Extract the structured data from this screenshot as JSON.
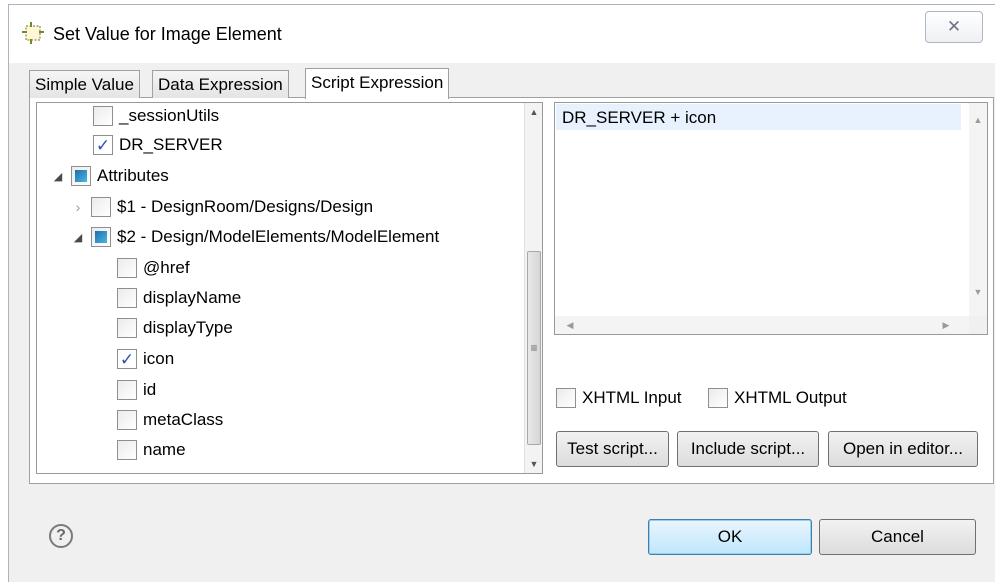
{
  "window": {
    "title": "Set Value for Image Element",
    "close_glyph": "✕"
  },
  "tabs": [
    {
      "label": "Simple Value",
      "active": false
    },
    {
      "label": "Data Expression",
      "active": false
    },
    {
      "label": "Script Expression",
      "active": true
    }
  ],
  "tree": {
    "items": [
      {
        "label": "_sessionUtils",
        "state": "unchecked"
      },
      {
        "label": "DR_SERVER",
        "state": "checked"
      },
      {
        "label": "Attributes",
        "state": "partial",
        "expanded": true
      },
      {
        "label": "$1 - DesignRoom/Designs/Design",
        "state": "unchecked",
        "expanded": false
      },
      {
        "label": "$2 - Design/ModelElements/ModelElement",
        "state": "partial",
        "expanded": true
      },
      {
        "label": "@href",
        "state": "unchecked"
      },
      {
        "label": "displayName",
        "state": "unchecked"
      },
      {
        "label": "displayType",
        "state": "unchecked"
      },
      {
        "label": "icon",
        "state": "checked"
      },
      {
        "label": "id",
        "state": "unchecked"
      },
      {
        "label": "metaClass",
        "state": "unchecked"
      },
      {
        "label": "name",
        "state": "unchecked"
      }
    ]
  },
  "script": {
    "text": "DR_SERVER + icon"
  },
  "options": {
    "xhtml_input_label": "XHTML Input",
    "xhtml_input_checked": false,
    "xhtml_output_label": "XHTML Output",
    "xhtml_output_checked": false
  },
  "script_buttons": {
    "test": "Test script...",
    "include": "Include script...",
    "open": "Open in editor..."
  },
  "footer": {
    "help_glyph": "?",
    "ok_label": "OK",
    "cancel_label": "Cancel"
  },
  "glyphs": {
    "check": "✓",
    "expanded": "◢",
    "collapsed": "›",
    "scroll_up": "▲",
    "scroll_down": "▼",
    "scroll_left": "◀",
    "scroll_right": "▶",
    "thumb_grip": "≡"
  },
  "colors": {
    "partial_fill": "#2a8fcf",
    "check_mark": "#2a4fb5",
    "selection_line": "#e8f2fe",
    "ok_border": "#3c7fb1"
  }
}
